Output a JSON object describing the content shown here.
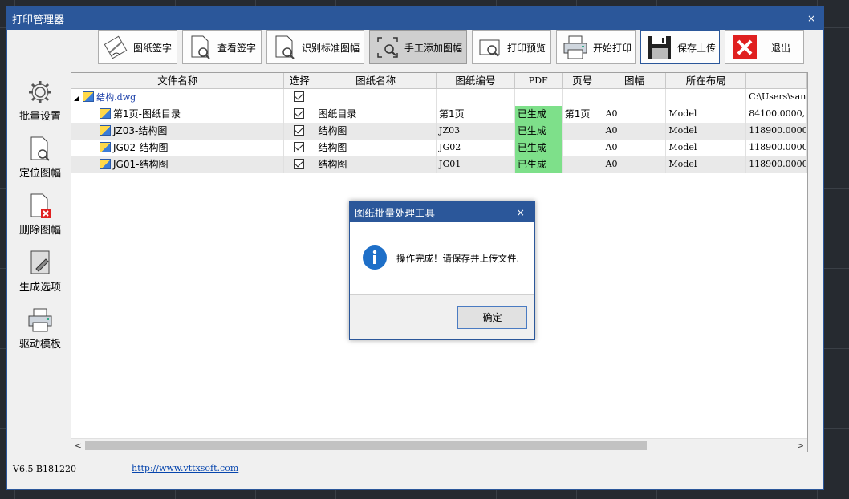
{
  "window": {
    "title": "打印管理器",
    "close": "×"
  },
  "toolbar": {
    "buttons": [
      {
        "label": "图纸签字",
        "icon": "sign-icon"
      },
      {
        "label": "查看签字",
        "icon": "search-doc-icon"
      },
      {
        "label": "识别标准图幅",
        "icon": "search-doc-icon"
      },
      {
        "label": "手工添加图幅",
        "icon": "manual-add-icon"
      },
      {
        "label": "打印预览",
        "icon": "preview-icon"
      },
      {
        "label": "开始打印",
        "icon": "printer-icon"
      },
      {
        "label": "保存上传",
        "icon": "save-icon"
      },
      {
        "label": "退出",
        "icon": "exit-icon"
      }
    ]
  },
  "sidebar": {
    "items": [
      {
        "label": "批量设置",
        "icon": "gear-icon"
      },
      {
        "label": "定位图幅",
        "icon": "locate-icon"
      },
      {
        "label": "删除图幅",
        "icon": "delete-frame-icon"
      },
      {
        "label": "生成选项",
        "icon": "options-icon"
      },
      {
        "label": "驱动模板",
        "icon": "printer-icon"
      }
    ]
  },
  "grid": {
    "columns": [
      "文件名称",
      "选择",
      "图纸名称",
      "图纸编号",
      "PDF",
      "页号",
      "图幅",
      "所在布局",
      ""
    ],
    "parent": {
      "expand": "◢",
      "name": "结构.dwg",
      "path": "C:\\Users\\san"
    },
    "rows": [
      {
        "name": "第1页-图纸目录",
        "title": "图纸目录",
        "code": "第1页",
        "pdf": "已生成",
        "page": "第1页",
        "size": "A0",
        "layout": "Model",
        "extra": "84100.0000,1"
      },
      {
        "name": "JZ03-结构图",
        "title": "结构图",
        "code": "JZ03",
        "pdf": "已生成",
        "page": "",
        "size": "A0",
        "layout": "Model",
        "extra": "118900.0000,"
      },
      {
        "name": "JG02-结构图",
        "title": "结构图",
        "code": "JG02",
        "pdf": "已生成",
        "page": "",
        "size": "A0",
        "layout": "Model",
        "extra": "118900.0000,"
      },
      {
        "name": "JG01-结构图",
        "title": "结构图",
        "code": "JG01",
        "pdf": "已生成",
        "page": "",
        "size": "A0",
        "layout": "Model",
        "extra": "118900.0000,"
      }
    ]
  },
  "scrollbar": {
    "left": "<",
    "right": ">"
  },
  "status": {
    "version": "V6.5 B181220",
    "link": "http://www.vttxsoft.com"
  },
  "dialog": {
    "title": "图纸批量处理工具",
    "close": "×",
    "message": "操作完成！请保存并上传文件.",
    "ok": "确定"
  },
  "colors": {
    "accent": "#2b579a",
    "pdf_ok": "#7ee08a",
    "exit_red": "#e02020"
  }
}
